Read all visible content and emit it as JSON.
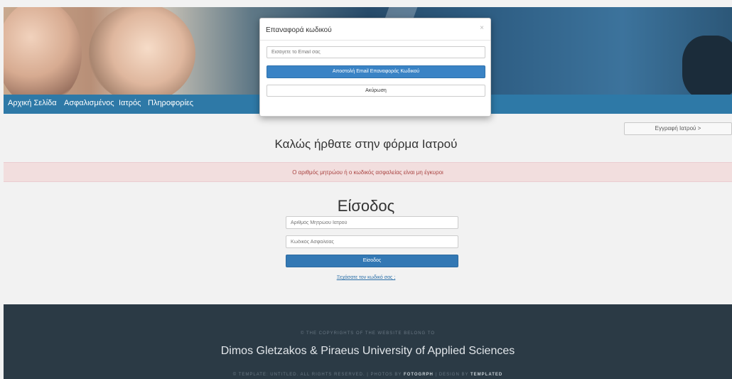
{
  "nav": {
    "items": [
      "Αρχική Σελίδα",
      "Ασφαλισμένος",
      "Ιατρός",
      "Πληροφορίες"
    ]
  },
  "register_button": "Εγγραφή Ιατρού >",
  "welcome_title": "Καλώς ήρθατε στην φόρμα Ιατρού",
  "alert_message": "Ο αριθμός μητρώου ή ο κωδικός ασφαλείας είναι μη έγκυροι",
  "login": {
    "title": "Είσοδος",
    "registry_placeholder": "Αριθμός Μητρώου Ιατρού",
    "security_placeholder": "Κωδικός Ασφαλείας",
    "submit_label": "Είσοδος",
    "forgot_link": "Ξεχάσατε τον κωδικό σας ;"
  },
  "modal": {
    "title": "Επαναφορά κωδικού",
    "close": "×",
    "email_placeholder": "Εισάγετε το Email σας",
    "send_label": "Αποστολή Email Επαναφοράς Κωδικού",
    "cancel_label": "Ακύρωση"
  },
  "footer": {
    "copyright_line": "© THE COPYRIGHTS OF THE WEBSITE BELONG TO",
    "owner": "Dimos Gletzakos & Piraeus University of Applied Sciences",
    "credits_prefix": "© TEMPLATE: UNTITLED. ALL RIGHTS RESERVED. | PHOTOS BY ",
    "credits_photos": "FOTOGRPH",
    "credits_mid": " | DESIGN BY ",
    "credits_design": "TEMPLATED"
  },
  "colors": {
    "nav_bg": "#2e79a7",
    "primary_button": "#3378b4",
    "alert_bg": "#f2dede",
    "alert_text": "#a94442",
    "footer_bg": "#2b3a45"
  }
}
